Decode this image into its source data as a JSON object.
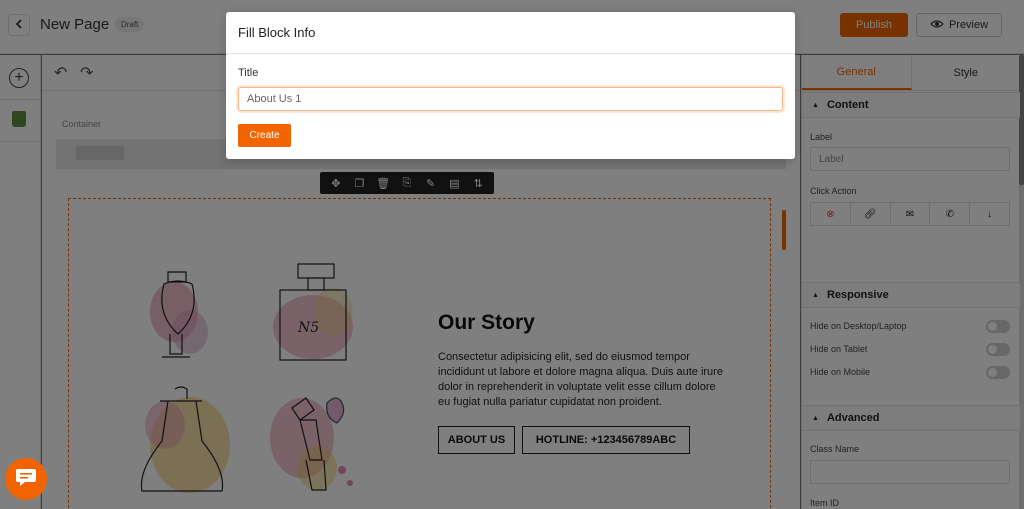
{
  "header": {
    "page_title": "New Page",
    "status_badge": "Draft",
    "publish_label": "Publish",
    "preview_label": "Preview"
  },
  "canvas": {
    "container_label": "Container",
    "story_title": "Our Story",
    "story_text": "Consectetur adipisicing elit, sed do eiusmod tempor incididunt ut labore et dolore magna aliqua. Duis aute irure dolor in reprehenderit in voluptate velit esse cillum dolore eu fugiat nulla pariatur cupidatat non proident.",
    "about_button": "ABOUT US",
    "hotline_button": "HOTLINE: +123456789ABC"
  },
  "right_panel": {
    "tabs": [
      "General",
      "Style"
    ],
    "active_tab": "General",
    "sections": {
      "content": {
        "title": "Content",
        "label_field_label": "Label",
        "label_placeholder": "Label",
        "click_action_label": "Click Action"
      },
      "responsive": {
        "title": "Responsive",
        "toggles": [
          "Hide on Desktop/Laptop",
          "Hide on Tablet",
          "Hide on Mobile"
        ]
      },
      "advanced": {
        "title": "Advanced",
        "class_name_label": "Class Name",
        "item_id_label": "Item ID"
      }
    }
  },
  "modal": {
    "title": "Fill Block Info",
    "field_label": "Title",
    "field_value": "About Us 1",
    "create_label": "Create"
  },
  "colors": {
    "accent": "#f16400",
    "overlay": "rgba(0,0,0,0.5)"
  }
}
